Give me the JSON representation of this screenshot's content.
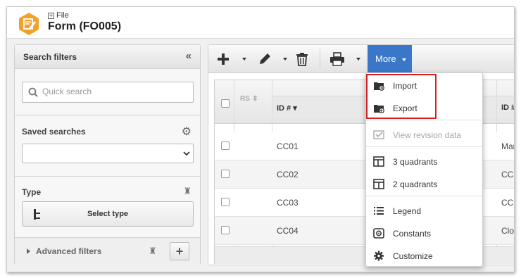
{
  "header": {
    "breadcrumb": "File",
    "title": "Form (FO005)"
  },
  "sidebar": {
    "title": "Search filters",
    "quick_search_placeholder": "Quick search",
    "saved_searches_label": "Saved searches",
    "saved_searches_value": "",
    "type_label": "Type",
    "select_type_button": "Select type",
    "advanced_filters_label": "Advanced filters"
  },
  "toolbar": {
    "more_label": "More"
  },
  "grid": {
    "columns": [
      "RS",
      "ID #",
      "ID #"
    ],
    "rows": [
      {
        "id": "CC01",
        "desc": "Mar"
      },
      {
        "id": "CC02",
        "desc": "CC"
      },
      {
        "id": "CC03",
        "desc": "CC"
      },
      {
        "id": "CC04",
        "desc": "Clo"
      }
    ]
  },
  "menu": {
    "items": [
      {
        "label": "Import",
        "icon": "folder-import-icon"
      },
      {
        "label": "Export",
        "icon": "folder-export-icon"
      },
      {
        "label": "View revision data",
        "icon": "revision-icon",
        "disabled": true
      },
      {
        "label": "3 quadrants",
        "icon": "three-quadrants-icon"
      },
      {
        "label": "2 quadrants",
        "icon": "two-quadrants-icon"
      },
      {
        "label": "Legend",
        "icon": "legend-icon"
      },
      {
        "label": "Constants",
        "icon": "constants-icon"
      },
      {
        "label": "Customize",
        "icon": "gear-icon"
      }
    ]
  },
  "colors": {
    "accent": "#3a77c9",
    "highlight": "#d42020",
    "app_icon": "#f0a32a"
  }
}
